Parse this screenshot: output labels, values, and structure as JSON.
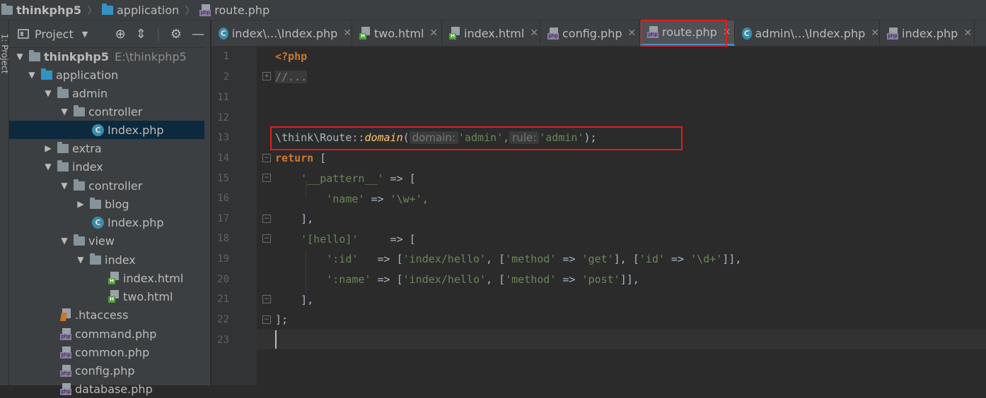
{
  "breadcrumb": {
    "items": [
      {
        "label": "thinkphp5",
        "icon": "folder-icon"
      },
      {
        "label": "application",
        "icon": "folder-icon"
      },
      {
        "label": "route.php",
        "icon": "php-file-icon"
      }
    ]
  },
  "side_strip": {
    "label": "1: Project"
  },
  "project_panel": {
    "title": "Project",
    "tools": [
      "locate-icon",
      "collapse-icon",
      "gear-icon",
      "hide-icon"
    ],
    "tree": [
      {
        "label": "thinkphp5",
        "path": "E:\\thinkphp5",
        "depth": 0,
        "expanded": true,
        "type": "folder"
      },
      {
        "label": "application",
        "depth": 1,
        "expanded": true,
        "type": "folder-blue"
      },
      {
        "label": "admin",
        "depth": 2,
        "expanded": true,
        "type": "folder"
      },
      {
        "label": "controller",
        "depth": 3,
        "expanded": true,
        "type": "folder"
      },
      {
        "label": "Index.php",
        "depth": 4,
        "type": "class",
        "selected": true
      },
      {
        "label": "extra",
        "depth": 2,
        "expanded": false,
        "type": "folder"
      },
      {
        "label": "index",
        "depth": 2,
        "expanded": true,
        "type": "folder"
      },
      {
        "label": "controller",
        "depth": 3,
        "expanded": true,
        "type": "folder"
      },
      {
        "label": "blog",
        "depth": 4,
        "expanded": false,
        "type": "folder"
      },
      {
        "label": "Index.php",
        "depth": 4,
        "type": "class"
      },
      {
        "label": "view",
        "depth": 3,
        "expanded": true,
        "type": "folder"
      },
      {
        "label": "index",
        "depth": 4,
        "expanded": true,
        "type": "folder"
      },
      {
        "label": "index.html",
        "depth": 5,
        "type": "html"
      },
      {
        "label": "two.html",
        "depth": 5,
        "type": "html"
      },
      {
        "label": ".htaccess",
        "depth": 2,
        "type": "htaccess"
      },
      {
        "label": "command.php",
        "depth": 2,
        "type": "php"
      },
      {
        "label": "common.php",
        "depth": 2,
        "type": "php"
      },
      {
        "label": "config.php",
        "depth": 2,
        "type": "php"
      },
      {
        "label": "database.php",
        "depth": 2,
        "type": "php"
      }
    ]
  },
  "tabs": [
    {
      "label": "index\\...\\Index.php",
      "type": "class"
    },
    {
      "label": "two.html",
      "type": "html"
    },
    {
      "label": "index.html",
      "type": "html"
    },
    {
      "label": "config.php",
      "type": "php"
    },
    {
      "label": "route.php",
      "type": "php",
      "active": true
    },
    {
      "label": "admin\\...\\Index.php",
      "type": "class"
    },
    {
      "label": "index.php",
      "type": "php"
    }
  ],
  "editor": {
    "line_numbers": [
      "1",
      "2",
      "11",
      "12",
      "13",
      "14",
      "15",
      "16",
      "17",
      "18",
      "19",
      "20",
      "21",
      "22",
      "23"
    ],
    "code": {
      "l1": "<?php",
      "l2": "//...",
      "l13_prefix": "\\think\\Route::",
      "l13_fn": "domain",
      "l13_open": "(",
      "l13_hint1": "domain:",
      "l13_arg1": "'admin'",
      "l13_comma": ",",
      "l13_hint2": "rule:",
      "l13_arg2": "'admin'",
      "l13_close": ");",
      "l14_kw": "return",
      "l14_rest": " [",
      "l15_str": "'__pattern__'",
      "l15_rest": " => [",
      "l16_str1": "'name'",
      "l16_mid": " => ",
      "l16_str2": "'\\w+'",
      "l16_end": ",",
      "l17": "],",
      "l18_str": "'[hello]'",
      "l18_rest": "     => [",
      "l19_s1": "':id'",
      "l19_a": "   => [",
      "l19_s2": "'index/hello'",
      "l19_b": ", [",
      "l19_s3": "'method'",
      "l19_c": " => ",
      "l19_s4": "'get'",
      "l19_d": "], [",
      "l19_s5": "'id'",
      "l19_e": " => ",
      "l19_s6": "'\\d+'",
      "l19_f": "]],",
      "l20_s1": "':name'",
      "l20_a": " => [",
      "l20_s2": "'index/hello'",
      "l20_b": ", [",
      "l20_s3": "'method'",
      "l20_c": " => ",
      "l20_s4": "'post'",
      "l20_d": "]],",
      "l21": "],",
      "l22": "];"
    }
  },
  "colors": {
    "highlight_box": "#e31c1c",
    "keyword": "#cc7832",
    "string": "#6a8759",
    "function": "#ffc66d",
    "active_tab_underline": "#4a88c7"
  }
}
